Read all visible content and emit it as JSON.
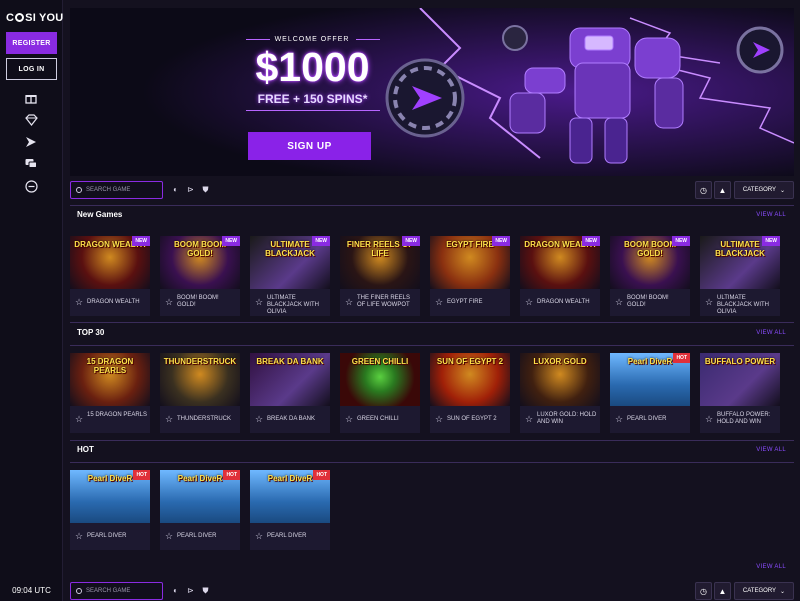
{
  "brand": {
    "logo": "CASI YOU",
    "logo_pre": "C",
    "logo_post": "SI YOU"
  },
  "sidebar": {
    "register": "REGISTER",
    "login": "LOG IN",
    "icons": [
      "gift-icon",
      "diamond-icon",
      "promo-icon",
      "chat-icon",
      "more-icon"
    ],
    "time": "09:04 UTC"
  },
  "hero": {
    "welcome": "WELCOME OFFER",
    "amount": "$1000",
    "spins": "FREE + 150 SPINS*",
    "cta": "SIGN UP"
  },
  "toolbar": {
    "search_placeholder": "SEARCH GAME",
    "category": "CATEGORY"
  },
  "sections": [
    {
      "title": "New Games",
      "view_all": "VIEW ALL",
      "games": [
        {
          "title": "DRAGON WEALTH",
          "art": "DRAGON WEALTH",
          "badge": "NEW",
          "bg": "#5a1010"
        },
        {
          "title": "BOOM! BOOM! GOLD!",
          "art": "BOOM BOOM GOLD!",
          "badge": "NEW",
          "bg": "#3a1050"
        },
        {
          "title": "ULTIMATE BLACKJACK WITH OLIVIA",
          "art": "ULTIMATE BLACKJACK",
          "badge": "NEW",
          "bg": "#1a1a1a"
        },
        {
          "title": "THE FINER REELS OF LIFE WOWPOT",
          "art": "FINER REELS OF LIFE",
          "badge": "NEW",
          "bg": "#2a1515"
        },
        {
          "title": "EGYPT FIRE",
          "art": "EGYPT FIRE",
          "badge": "NEW",
          "bg": "#8a3010"
        },
        {
          "title": "DRAGON WEALTH",
          "art": "DRAGON WEALTH",
          "badge": "NEW",
          "bg": "#5a1010"
        },
        {
          "title": "BOOM! BOOM! GOLD!",
          "art": "BOOM BOOM GOLD!",
          "badge": "NEW",
          "bg": "#3a1050"
        },
        {
          "title": "ULTIMATE BLACKJACK WITH OLIVIA",
          "art": "ULTIMATE BLACKJACK",
          "badge": "NEW",
          "bg": "#1a1a1a"
        }
      ]
    },
    {
      "title": "TOP 30",
      "view_all": "VIEW ALL",
      "games": [
        {
          "title": "15 DRAGON PEARLS",
          "art": "15 DRAGON PEARLS",
          "badge": "",
          "bg": "#6a2010"
        },
        {
          "title": "THUNDERSTRUCK",
          "art": "THUNDERSTRUCK",
          "badge": "",
          "bg": "#3a3020"
        },
        {
          "title": "BREAK DA BANK",
          "art": "BREAK DA BANK",
          "badge": "",
          "bg": "#301040"
        },
        {
          "title": "GREEN CHILLI",
          "art": "GREEN CHILLI",
          "badge": "",
          "bg": "#3a0808"
        },
        {
          "title": "SUN OF EGYPT 2",
          "art": "SUN OF EGYPT 2",
          "badge": "",
          "bg": "#a02008"
        },
        {
          "title": "LUXOR GOLD: HOLD AND WIN",
          "art": "LUXOR GOLD",
          "badge": "",
          "bg": "#402010"
        },
        {
          "title": "PEARL DIVER",
          "art": "Pearl DiveR",
          "badge": "HOT",
          "bg": "#2a6ab0"
        },
        {
          "title": "BUFFALO POWER: HOLD AND WIN",
          "art": "BUFFALO POWER",
          "badge": "",
          "bg": "#3a2a70"
        }
      ]
    },
    {
      "title": "HOT",
      "view_all": "VIEW ALL",
      "games": [
        {
          "title": "PEARL DIVER",
          "art": "Pearl DiveR",
          "badge": "HOT",
          "bg": "#2a6ab0"
        },
        {
          "title": "PEARL DIVER",
          "art": "Pearl DiveR",
          "badge": "HOT",
          "bg": "#2a6ab0"
        },
        {
          "title": "PEARL DIVER",
          "art": "Pearl DiveR",
          "badge": "HOT",
          "bg": "#2a6ab0"
        }
      ]
    },
    {
      "title": "",
      "view_all": "VIEW ALL",
      "games": []
    }
  ],
  "colors": {
    "accent": "#8a2be2",
    "bg": "#14111f",
    "hot": "#e0303a",
    "link": "#8a4cff"
  }
}
